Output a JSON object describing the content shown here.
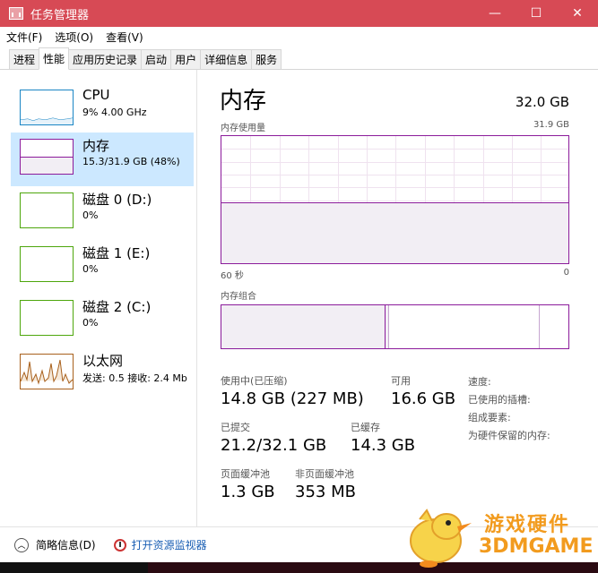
{
  "window": {
    "title": "任务管理器",
    "minimize": "—",
    "maximize": "☐",
    "close": "✕"
  },
  "menu": [
    "文件(F)",
    "选项(O)",
    "查看(V)"
  ],
  "tabs": [
    "进程",
    "性能",
    "应用历史记录",
    "启动",
    "用户",
    "详细信息",
    "服务"
  ],
  "active_tab": 1,
  "resources": [
    {
      "name": "CPU",
      "sub": "9% 4.00 GHz",
      "color": "#1a86c5"
    },
    {
      "name": "内存",
      "sub": "15.3/31.9 GB (48%)",
      "color": "#8b1b9b"
    },
    {
      "name": "磁盘 0 (D:)",
      "sub": "0%",
      "color": "#4da60c"
    },
    {
      "name": "磁盘 1 (E:)",
      "sub": "0%",
      "color": "#4da60c"
    },
    {
      "name": "磁盘 2 (C:)",
      "sub": "0%",
      "color": "#4da60c"
    },
    {
      "name": "以太网",
      "sub": "发送: 0.5 接收: 2.4 Mb",
      "color": "#a8601c"
    }
  ],
  "detail": {
    "title": "内存",
    "total": "32.0 GB",
    "usage_label": "内存使用量",
    "usage_max": "31.9 GB",
    "time_left": "60 秒",
    "time_right": "0",
    "usage_fraction": 0.48,
    "composition_label": "内存组合",
    "stats": {
      "in_use_label": "使用中(已压缩)",
      "in_use_value": "14.8 GB (227 MB)",
      "available_label": "可用",
      "available_value": "16.6 GB",
      "committed_label": "已提交",
      "committed_value": "21.2/32.1 GB",
      "cached_label": "已缓存",
      "cached_value": "14.3 GB",
      "paged_label": "页面缓冲池",
      "paged_value": "1.3 GB",
      "nonpaged_label": "非页面缓冲池",
      "nonpaged_value": "353 MB"
    },
    "kv": [
      "速度:",
      "已使用的插槽:",
      "组成要素:",
      "为硬件保留的内存:"
    ]
  },
  "footer": {
    "less_details": "简略信息(D)",
    "open_monitor": "打开资源监视器"
  },
  "watermark": {
    "line1": "游戏硬件",
    "line2": "3DMGAME"
  }
}
